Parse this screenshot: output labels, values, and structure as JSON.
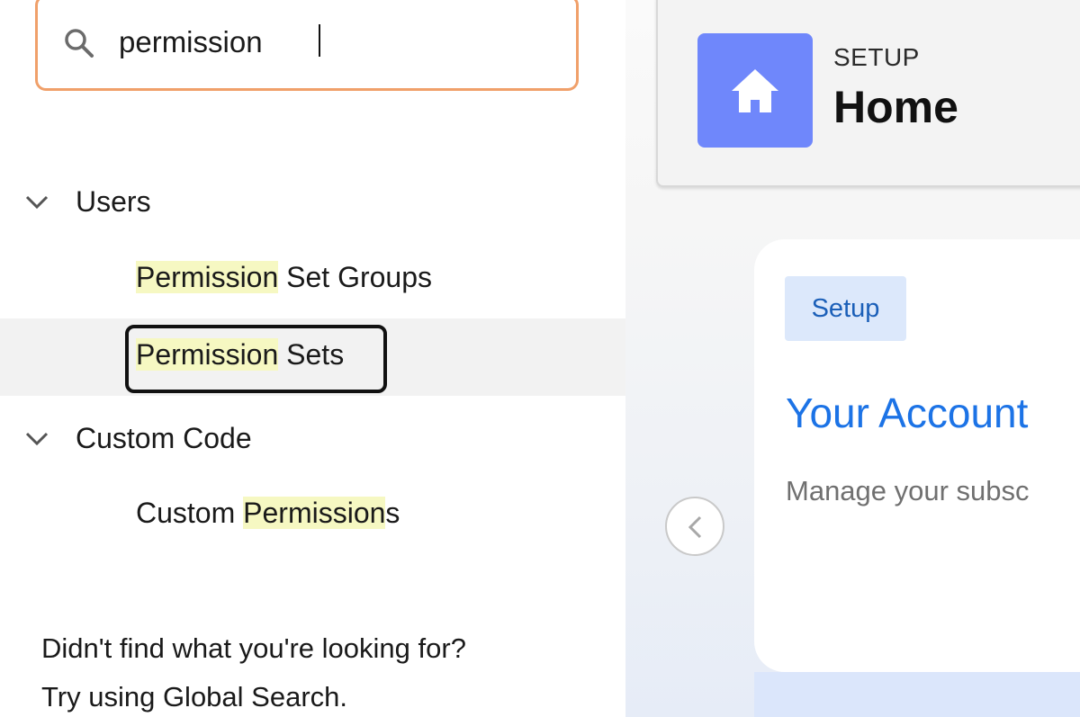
{
  "search": {
    "value": "permission",
    "icon": "search-icon"
  },
  "results": {
    "groups": [
      {
        "label": "Users",
        "items": [
          {
            "match": "Permission",
            "rest": " Set Groups"
          },
          {
            "match": "Permission",
            "rest": " Sets",
            "selected": true
          }
        ]
      },
      {
        "label": "Custom Code",
        "items": [
          {
            "pre": "Custom ",
            "match": "Permission",
            "rest": "s"
          }
        ]
      }
    ],
    "help_line1": "Didn't find what you're looking for?",
    "help_line2": "Try using Global Search."
  },
  "header": {
    "eyebrow": "SETUP",
    "title": "Home"
  },
  "card": {
    "badge": "Setup",
    "title": "Your Account",
    "description": "Manage your subsc"
  },
  "colors": {
    "search_border": "#f0a06a",
    "highlight": "#f6f8c2",
    "home_tile": "#6f87fb",
    "link_blue": "#1c73e6"
  }
}
